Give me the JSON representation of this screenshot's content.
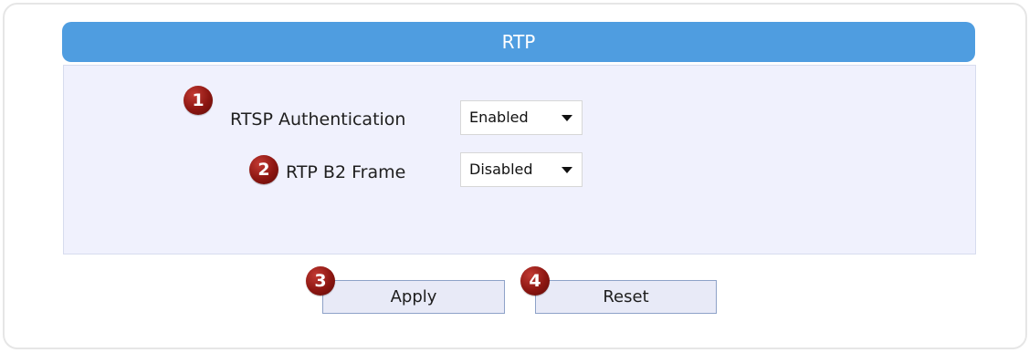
{
  "panel": {
    "title": "RTP"
  },
  "fields": [
    {
      "badge": "1",
      "label": "RTSP Authentication",
      "selected": "Enabled"
    },
    {
      "badge": "2",
      "label": "RTP B2 Frame",
      "selected": "Disabled"
    }
  ],
  "actions": {
    "apply_badge": "3",
    "apply_label": "Apply",
    "reset_badge": "4",
    "reset_label": "Reset"
  },
  "colors": {
    "header": "#4f9de0",
    "panel_bg": "#f0f1fd",
    "badge": "#8c1611",
    "button_bg": "#e8eaf7"
  }
}
